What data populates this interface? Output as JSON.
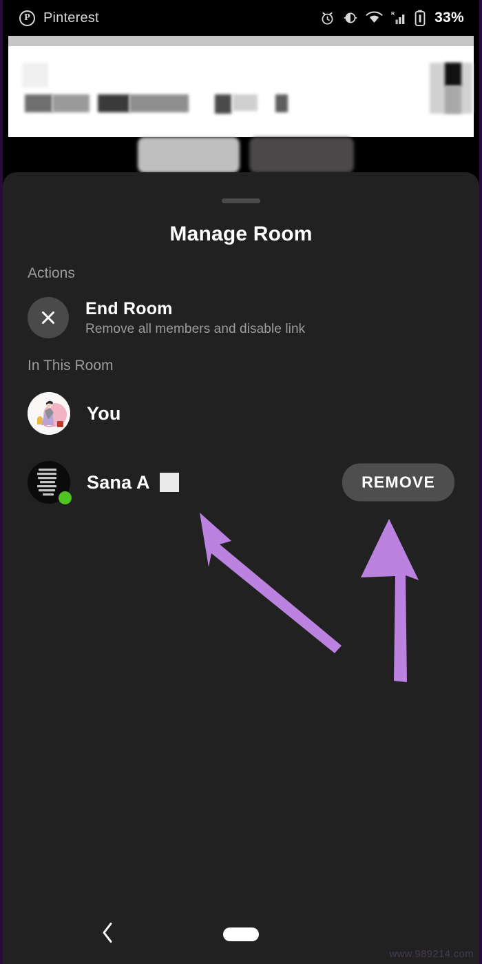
{
  "status_bar": {
    "app_icon": "pinterest-logo-icon",
    "app_name": "Pinterest",
    "logo_glyph": "P",
    "icons": [
      "alarm-clock-icon",
      "brightness-contrast-icon",
      "wifi-icon",
      "cellular-signal-roaming-icon",
      "battery-icon"
    ],
    "roaming_label": "R",
    "battery_percent": "33%"
  },
  "background_app": {
    "description": "blurred Pinterest content behind the sheet"
  },
  "sheet": {
    "drag_handle": "drag-handle",
    "title": "Manage Room",
    "sections": {
      "actions_label": "Actions",
      "room_label": "In This Room"
    },
    "actions": [
      {
        "icon": "close-x-icon",
        "title": "End Room",
        "subtitle": "Remove all members and disable link"
      }
    ],
    "members": [
      {
        "name": "You",
        "avatar": "user-illustration-avatar",
        "online": false,
        "redacted": false,
        "action_label": null
      },
      {
        "name": "Sana A",
        "avatar": "dark-text-avatar",
        "online": true,
        "redacted": true,
        "action_label": "REMOVE"
      }
    ]
  },
  "annotations": {
    "arrow_color": "#bb82e0",
    "arrows": [
      {
        "name": "arrow-pointing-to-member-name",
        "direction": "up-left"
      },
      {
        "name": "arrow-pointing-to-remove-button",
        "direction": "up"
      }
    ]
  },
  "nav_bar": {
    "back_icon": "back-chevron-icon",
    "home_pill": "home-indicator-pill"
  },
  "watermark": "www.989214.com",
  "colors": {
    "sheet_bg": "#212121",
    "screen_bg": "#000000",
    "accent_arrow": "#bb82e0",
    "online_green": "#4fc423",
    "button_gray": "#4e4e4e",
    "border_purple": "#2a0b3d"
  }
}
